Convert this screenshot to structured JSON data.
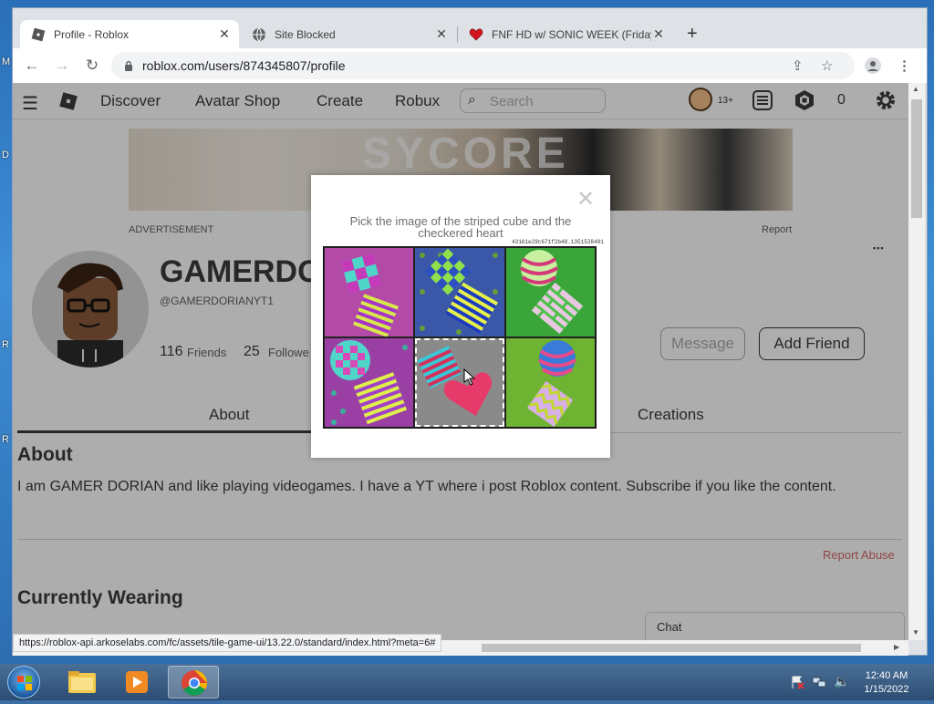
{
  "browser": {
    "tabs": [
      {
        "title": "Profile - Roblox",
        "icon": "roblox-icon",
        "active": true
      },
      {
        "title": "Site Blocked",
        "icon": "globe-icon",
        "active": false
      },
      {
        "title": "FNF HD w/ SONIC WEEK (Friday",
        "icon": "heart-icon",
        "active": false
      }
    ],
    "new_tab": "+",
    "url": "roblox.com/users/874345807/profile",
    "status_url": "https://roblox-api.arkoselabs.com/fc/assets/tile-game-ui/13.22.0/standard/index.html?meta=6#"
  },
  "window_controls": {
    "minimize": "▭",
    "maximize": "▣",
    "close": "✕"
  },
  "roblox": {
    "nav": [
      "Discover",
      "Avatar Shop",
      "Create",
      "Robux"
    ],
    "search_placeholder": "Search",
    "age_badge": "13+",
    "robux_count": "0",
    "ad_label": "ADVERTISEMENT",
    "report_label": "Report",
    "banner_text": "SYCORE",
    "username": "GAMERDC",
    "handle": "@GAMERDORIANYT1",
    "friends_count": "116",
    "friends_label": "Friends",
    "followers_count": "25",
    "followers_label": "Followe",
    "message_button": "Message",
    "add_friend_button": "Add Friend",
    "more_menu": "▪▪▪",
    "tabs": [
      "About",
      "Creations"
    ],
    "about_heading": "About",
    "about_text": "I am GAMER DORIAN and like playing videogames. I have a YT where i post Roblox content. Subscribe if you like the content.",
    "report_abuse": "Report Abuse",
    "wearing_heading": "Currently Wearing",
    "chat_label": "Chat"
  },
  "captcha": {
    "close": "✕",
    "instruction": "Pick the image of the striped cube and the checkered heart",
    "code": "43161e29c671f2b48.1351528401",
    "tiles": [
      {
        "bg": "#b24aa6",
        "selected": false
      },
      {
        "bg": "#3a57a8",
        "selected": false
      },
      {
        "bg": "#3aa63a",
        "selected": false
      },
      {
        "bg": "#9a3fa3",
        "selected": false
      },
      {
        "bg": "#8a8a8a",
        "selected": true
      },
      {
        "bg": "#6eb331",
        "selected": false
      }
    ]
  },
  "taskbar": {
    "clock_time": "12:40 AM",
    "clock_date": "1/15/2022"
  },
  "colors": {
    "accent": "#393b3d",
    "report": "#d86868",
    "desktop": "#2f7bc4"
  }
}
